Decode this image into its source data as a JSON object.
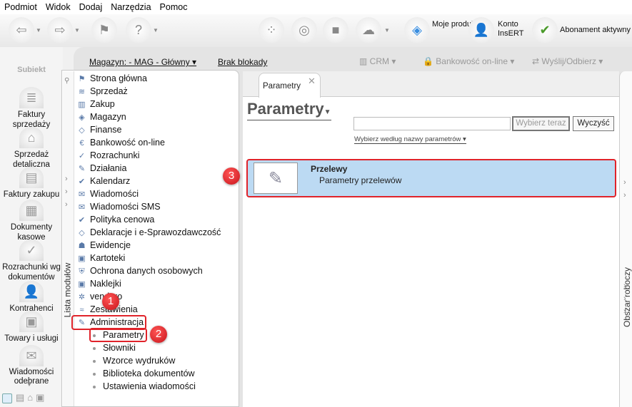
{
  "menu": [
    "Podmiot",
    "Widok",
    "Dodaj",
    "Narzędzia",
    "Pomoc"
  ],
  "toolbar": {
    "moje_produkty": "Moje produkty",
    "konto_insert": "Konto InsERT",
    "abonament": "Abonament aktywny"
  },
  "sidebar": {
    "logo": "Subiekt",
    "items": [
      "Faktury sprzedaży",
      "Sprzedaż detaliczna",
      "Faktury zakupu",
      "Dokumenty kasowe",
      "Rozrachunki wg dokumentów",
      "Kontrahenci",
      "Towary i usługi",
      "Wiadomości odebrane"
    ]
  },
  "header": {
    "magazyn": "Magazyn: - MAG - Główny",
    "blokada": "Brak blokady",
    "crm": "CRM",
    "bankowosc": "Bankowość on-line",
    "wyslij": "Wyślij/Odbierz"
  },
  "modules": {
    "vertical_label": "Lista modułów",
    "items": [
      "Strona główna",
      "Sprzedaż",
      "Zakup",
      "Magazyn",
      "Finanse",
      "Bankowość on-line",
      "Rozrachunki",
      "Działania",
      "Kalendarz",
      "Wiadomości",
      "Wiadomości SMS",
      "Polityka cenowa",
      "Deklaracje i e-Sprawozdawczość",
      "Ewidencje",
      "Kartoteki",
      "Ochrona danych osobowych",
      "Naklejki",
      "vendero",
      "Zestawienia",
      "Administracja"
    ],
    "subitems": [
      "Parametry",
      "Słowniki",
      "Wzorce wydruków",
      "Biblioteka dokumentów",
      "Ustawienia wiadomości"
    ]
  },
  "tab": {
    "label": "Parametry"
  },
  "main": {
    "title": "Parametry",
    "search_value": "",
    "select_button": "Wybierz teraz",
    "clear_button": "Wyczyść",
    "filter": "Wybierz według nazwy parametrów",
    "items": [
      {
        "title": "Przelewy",
        "subtitle": "Parametry przelewów"
      }
    ]
  },
  "right_strip": "Obszar roboczy",
  "badges": [
    "1",
    "2",
    "3"
  ],
  "colors": {
    "highlight": "#e0232a",
    "selected_row": "#bcdaf3"
  }
}
